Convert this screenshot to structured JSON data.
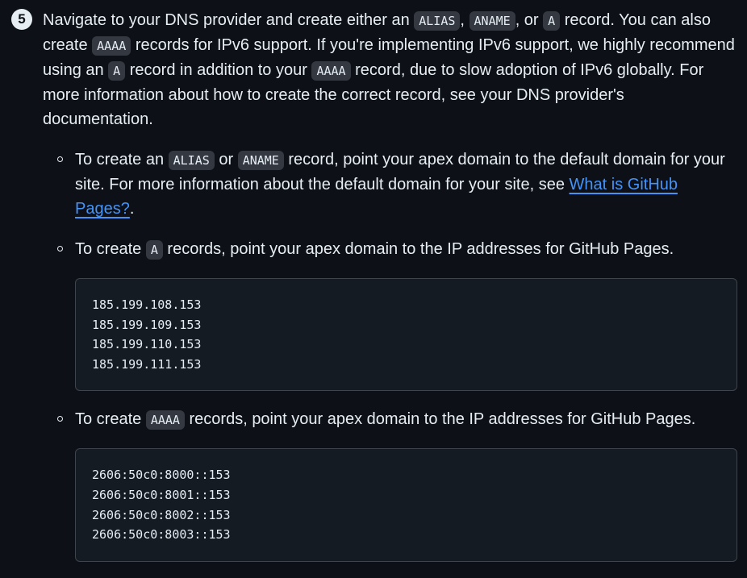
{
  "step": {
    "number": "5",
    "intro": [
      "Navigate to your DNS provider and create either an ",
      "ALIAS",
      ", ",
      "ANAME",
      ", or ",
      "A",
      " record. You can also create ",
      "AAAA",
      " records for IPv6 support. If you're implementing IPv6 support, we highly recommend using an ",
      "A",
      " record in addition to your ",
      "AAAA",
      " record, due to slow adoption of IPv6 globally. For more information about how to create the correct record, see your DNS provider's documentation."
    ]
  },
  "items": [
    {
      "parts": [
        "To create an ",
        "ALIAS",
        " or ",
        "ANAME",
        " record, point your apex domain to the default domain for your site. For more information about the default domain for your site, see "
      ],
      "link": "What is GitHub Pages?",
      "after": "."
    },
    {
      "parts": [
        "To create ",
        "A",
        " records, point your apex domain to the IP addresses for GitHub Pages."
      ],
      "code_lines": [
        "185.199.108.153",
        "185.199.109.153",
        "185.199.110.153",
        "185.199.111.153"
      ]
    },
    {
      "parts": [
        "To create ",
        "AAAA",
        " records, point your apex domain to the IP addresses for GitHub Pages."
      ],
      "code_lines": [
        "2606:50c0:8000::153",
        "2606:50c0:8001::153",
        "2606:50c0:8002::153",
        "2606:50c0:8003::153"
      ]
    }
  ]
}
